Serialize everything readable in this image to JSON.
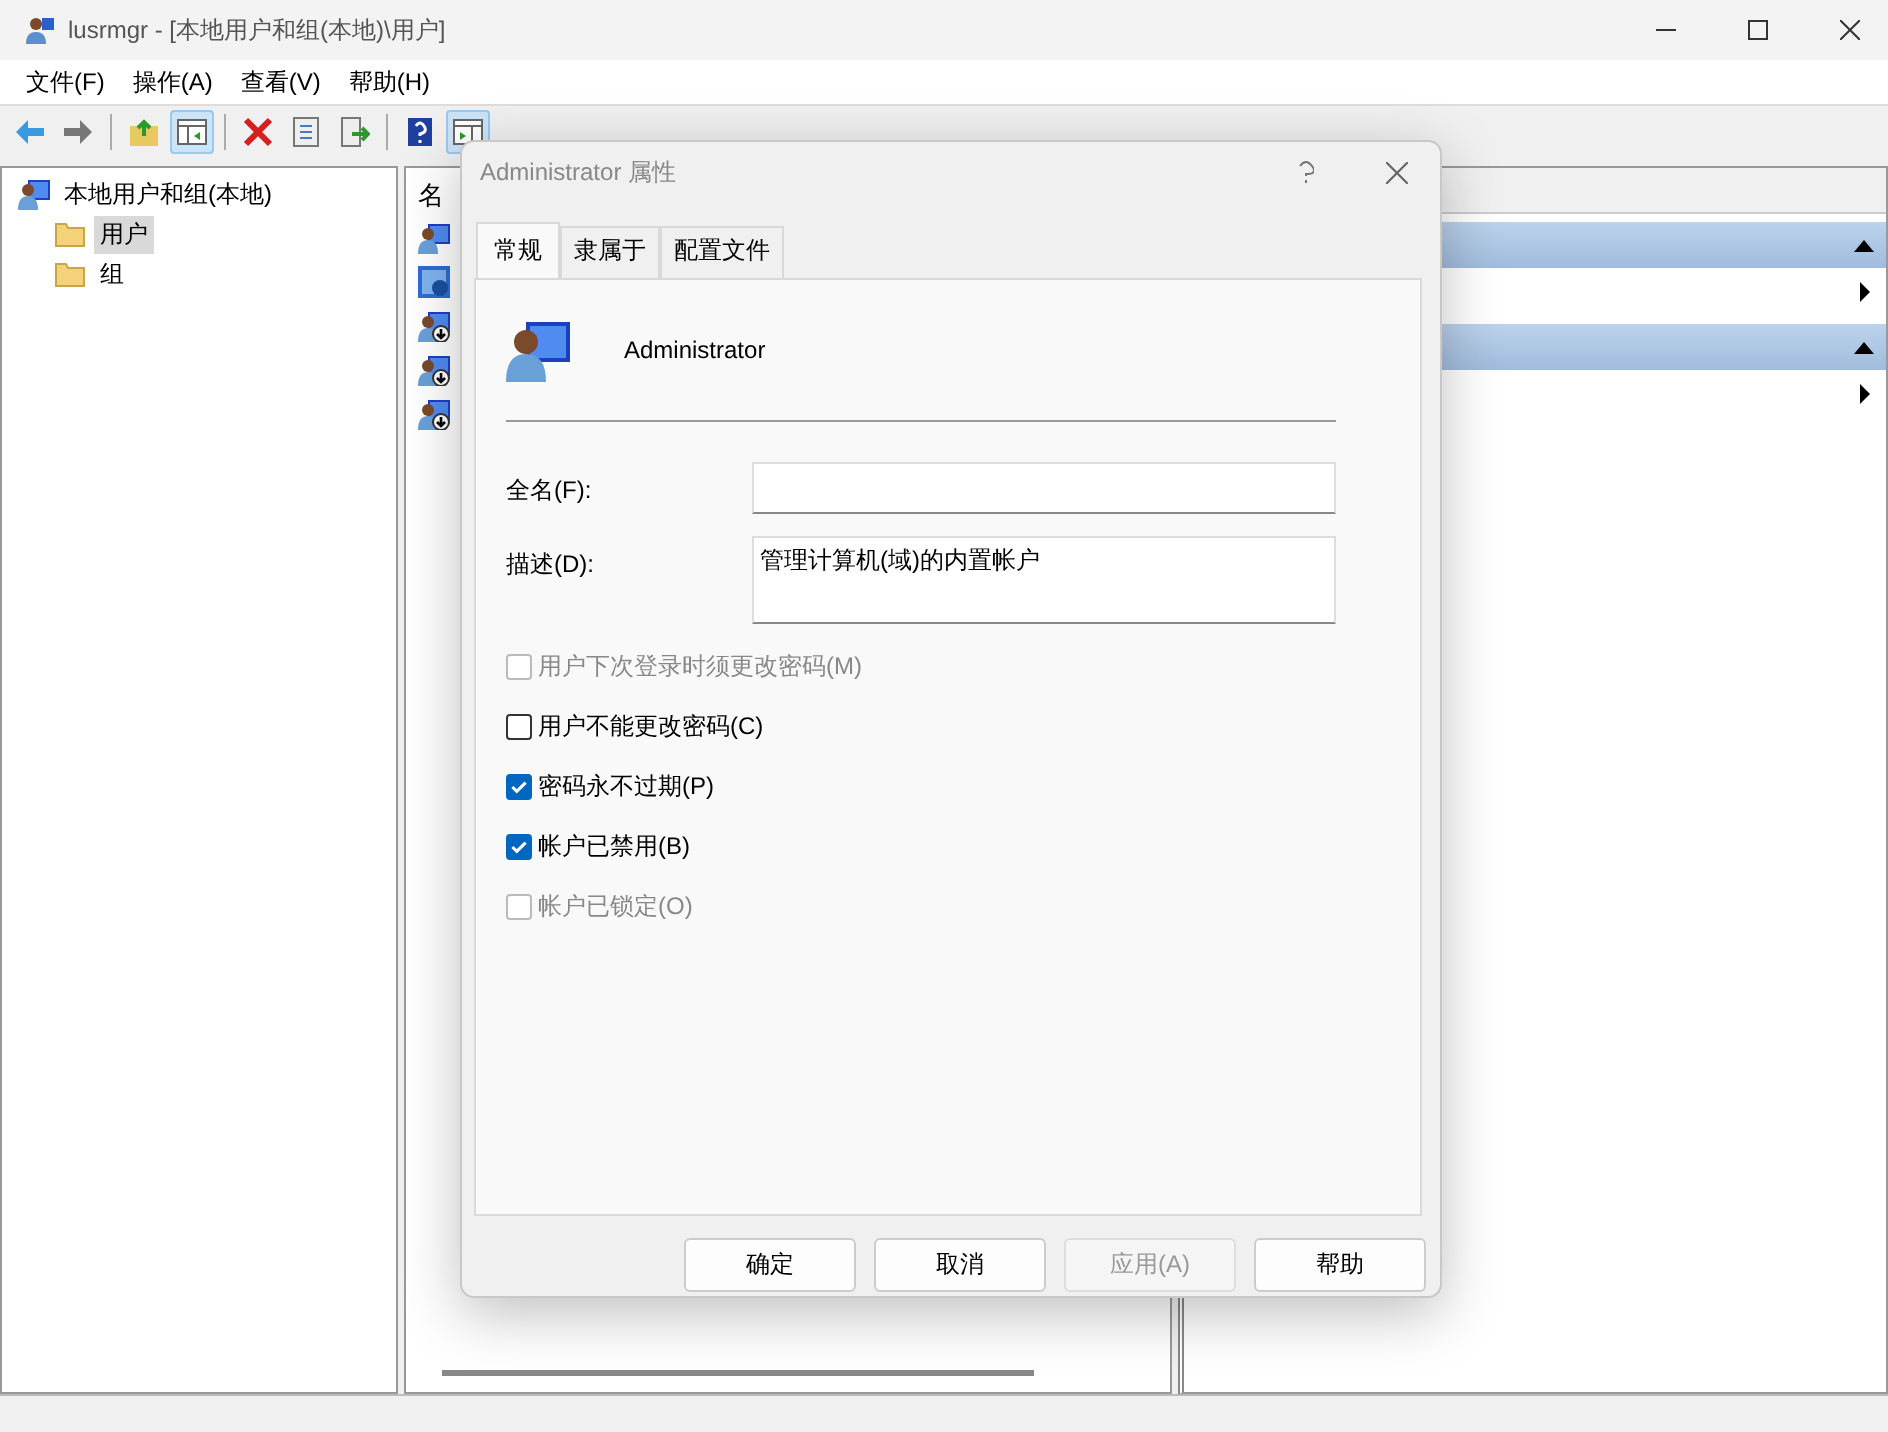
{
  "window": {
    "title": "lusrmgr - [本地用户和组(本地)\\用户]"
  },
  "menu": [
    "文件(F)",
    "操作(A)",
    "查看(V)",
    "帮助(H)"
  ],
  "toolbar": [
    {
      "kind": "back",
      "pressed": false
    },
    {
      "kind": "forward",
      "pressed": false
    },
    {
      "kind": "sep"
    },
    {
      "kind": "up",
      "pressed": false
    },
    {
      "kind": "tree",
      "pressed": true
    },
    {
      "kind": "sep"
    },
    {
      "kind": "delete",
      "pressed": false
    },
    {
      "kind": "properties",
      "pressed": false
    },
    {
      "kind": "export",
      "pressed": false
    },
    {
      "kind": "sep"
    },
    {
      "kind": "help",
      "pressed": false
    },
    {
      "kind": "actions",
      "pressed": true
    }
  ],
  "tree": {
    "label": "本地用户和组(本地)",
    "children": [
      {
        "label": "用户",
        "selected": true
      },
      {
        "label": "组",
        "selected": false
      }
    ]
  },
  "list": {
    "column_1": "名",
    "rows": [
      {
        "kind": "user"
      },
      {
        "kind": "admin"
      },
      {
        "kind": "disabled"
      },
      {
        "kind": "disabled"
      },
      {
        "kind": "disabled"
      }
    ]
  },
  "actions_pane": {
    "sections": [
      {
        "expanded": true
      },
      {
        "expanded": true
      }
    ]
  },
  "dialog": {
    "title": "Administrator 属性",
    "tabs": [
      {
        "label": "常规",
        "selected": true
      },
      {
        "label": "隶属于",
        "selected": false
      },
      {
        "label": "配置文件",
        "selected": false
      }
    ],
    "user_name": "Administrator",
    "fields": [
      {
        "label": "全名(F):",
        "kind": "line"
      },
      {
        "label": "描述(D):",
        "value": "管理计算机(域)的内置帐户",
        "kind": "area"
      }
    ],
    "checkboxes": [
      {
        "label": "用户下次登录时须更改密码(M)",
        "checked": false,
        "disabled": true
      },
      {
        "label": "用户不能更改密码(C)",
        "checked": false,
        "disabled": false
      },
      {
        "label": "密码永不过期(P)",
        "checked": true,
        "disabled": false
      },
      {
        "label": "帐户已禁用(B)",
        "checked": true,
        "disabled": false
      },
      {
        "label": "帐户已锁定(O)",
        "checked": false,
        "disabled": true
      }
    ],
    "buttons": [
      {
        "label": "确定",
        "disabled": false
      },
      {
        "label": "取消",
        "disabled": false
      },
      {
        "label": "应用(A)",
        "disabled": true
      },
      {
        "label": "帮助",
        "disabled": false
      }
    ]
  }
}
